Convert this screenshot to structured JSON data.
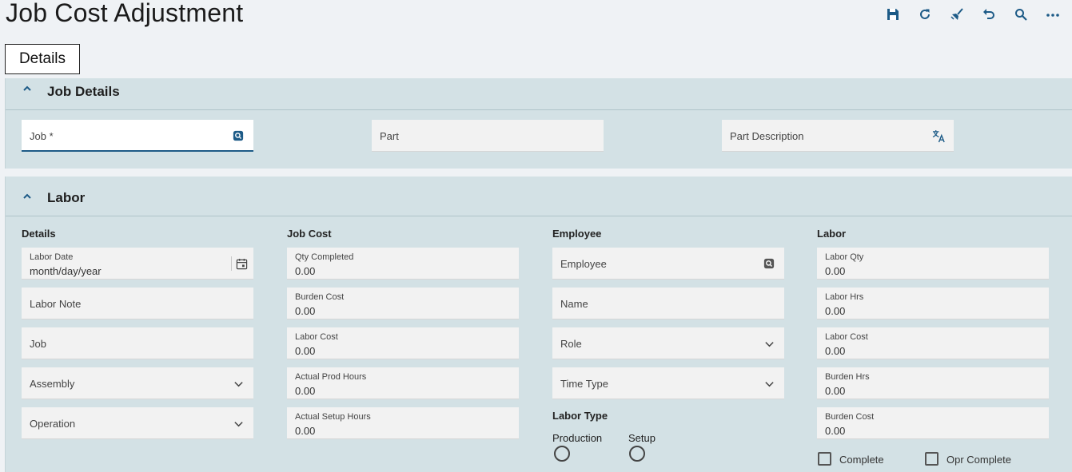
{
  "page": {
    "title": "Job Cost Adjustment"
  },
  "toolbar": {
    "items": [
      {
        "icon": "save-icon"
      },
      {
        "icon": "refresh-icon"
      },
      {
        "icon": "clear-brush-icon"
      },
      {
        "icon": "undo-icon"
      },
      {
        "icon": "search-icon"
      },
      {
        "icon": "more-icon"
      }
    ]
  },
  "tabs": {
    "details_label": "Details"
  },
  "job_details": {
    "title": "Job Details",
    "job_placeholder": "Job *",
    "part_placeholder": "Part",
    "part_description_placeholder": "Part Description"
  },
  "labor": {
    "title": "Labor",
    "details": {
      "heading": "Details",
      "labor_date_label": "Labor Date",
      "labor_date_value": "month/day/year",
      "labor_note": "Labor Note",
      "job": "Job",
      "assembly": "Assembly",
      "operation": "Operation"
    },
    "job_cost": {
      "heading": "Job Cost",
      "qty_completed_label": "Qty Completed",
      "qty_completed_value": "0.00",
      "burden_cost_label": "Burden Cost",
      "burden_cost_value": "0.00",
      "labor_cost_label": "Labor Cost",
      "labor_cost_value": "0.00",
      "actual_prod_hours_label": "Actual Prod Hours",
      "actual_prod_hours_value": "0.00",
      "actual_setup_hours_label": "Actual Setup Hours",
      "actual_setup_hours_value": "0.00"
    },
    "employee": {
      "heading": "Employee",
      "employee": "Employee",
      "name": "Name",
      "role": "Role",
      "time_type": "Time Type",
      "labor_type_heading": "Labor Type",
      "production_label": "Production",
      "setup_label": "Setup"
    },
    "labor_col": {
      "heading": "Labor",
      "labor_qty_label": "Labor Qty",
      "labor_qty_value": "0.00",
      "labor_hrs_label": "Labor Hrs",
      "labor_hrs_value": "0.00",
      "labor_cost_label": "Labor Cost",
      "labor_cost_value": "0.00",
      "burden_hrs_label": "Burden Hrs",
      "burden_hrs_value": "0.00",
      "burden_cost_label": "Burden Cost",
      "burden_cost_value": "0.00",
      "complete_label": "Complete",
      "opr_complete_label": "Opr Complete"
    }
  },
  "colors": {
    "accent": "#1d5b87",
    "panel_bg": "#d3e1e5",
    "page_bg": "#eff2f5"
  }
}
